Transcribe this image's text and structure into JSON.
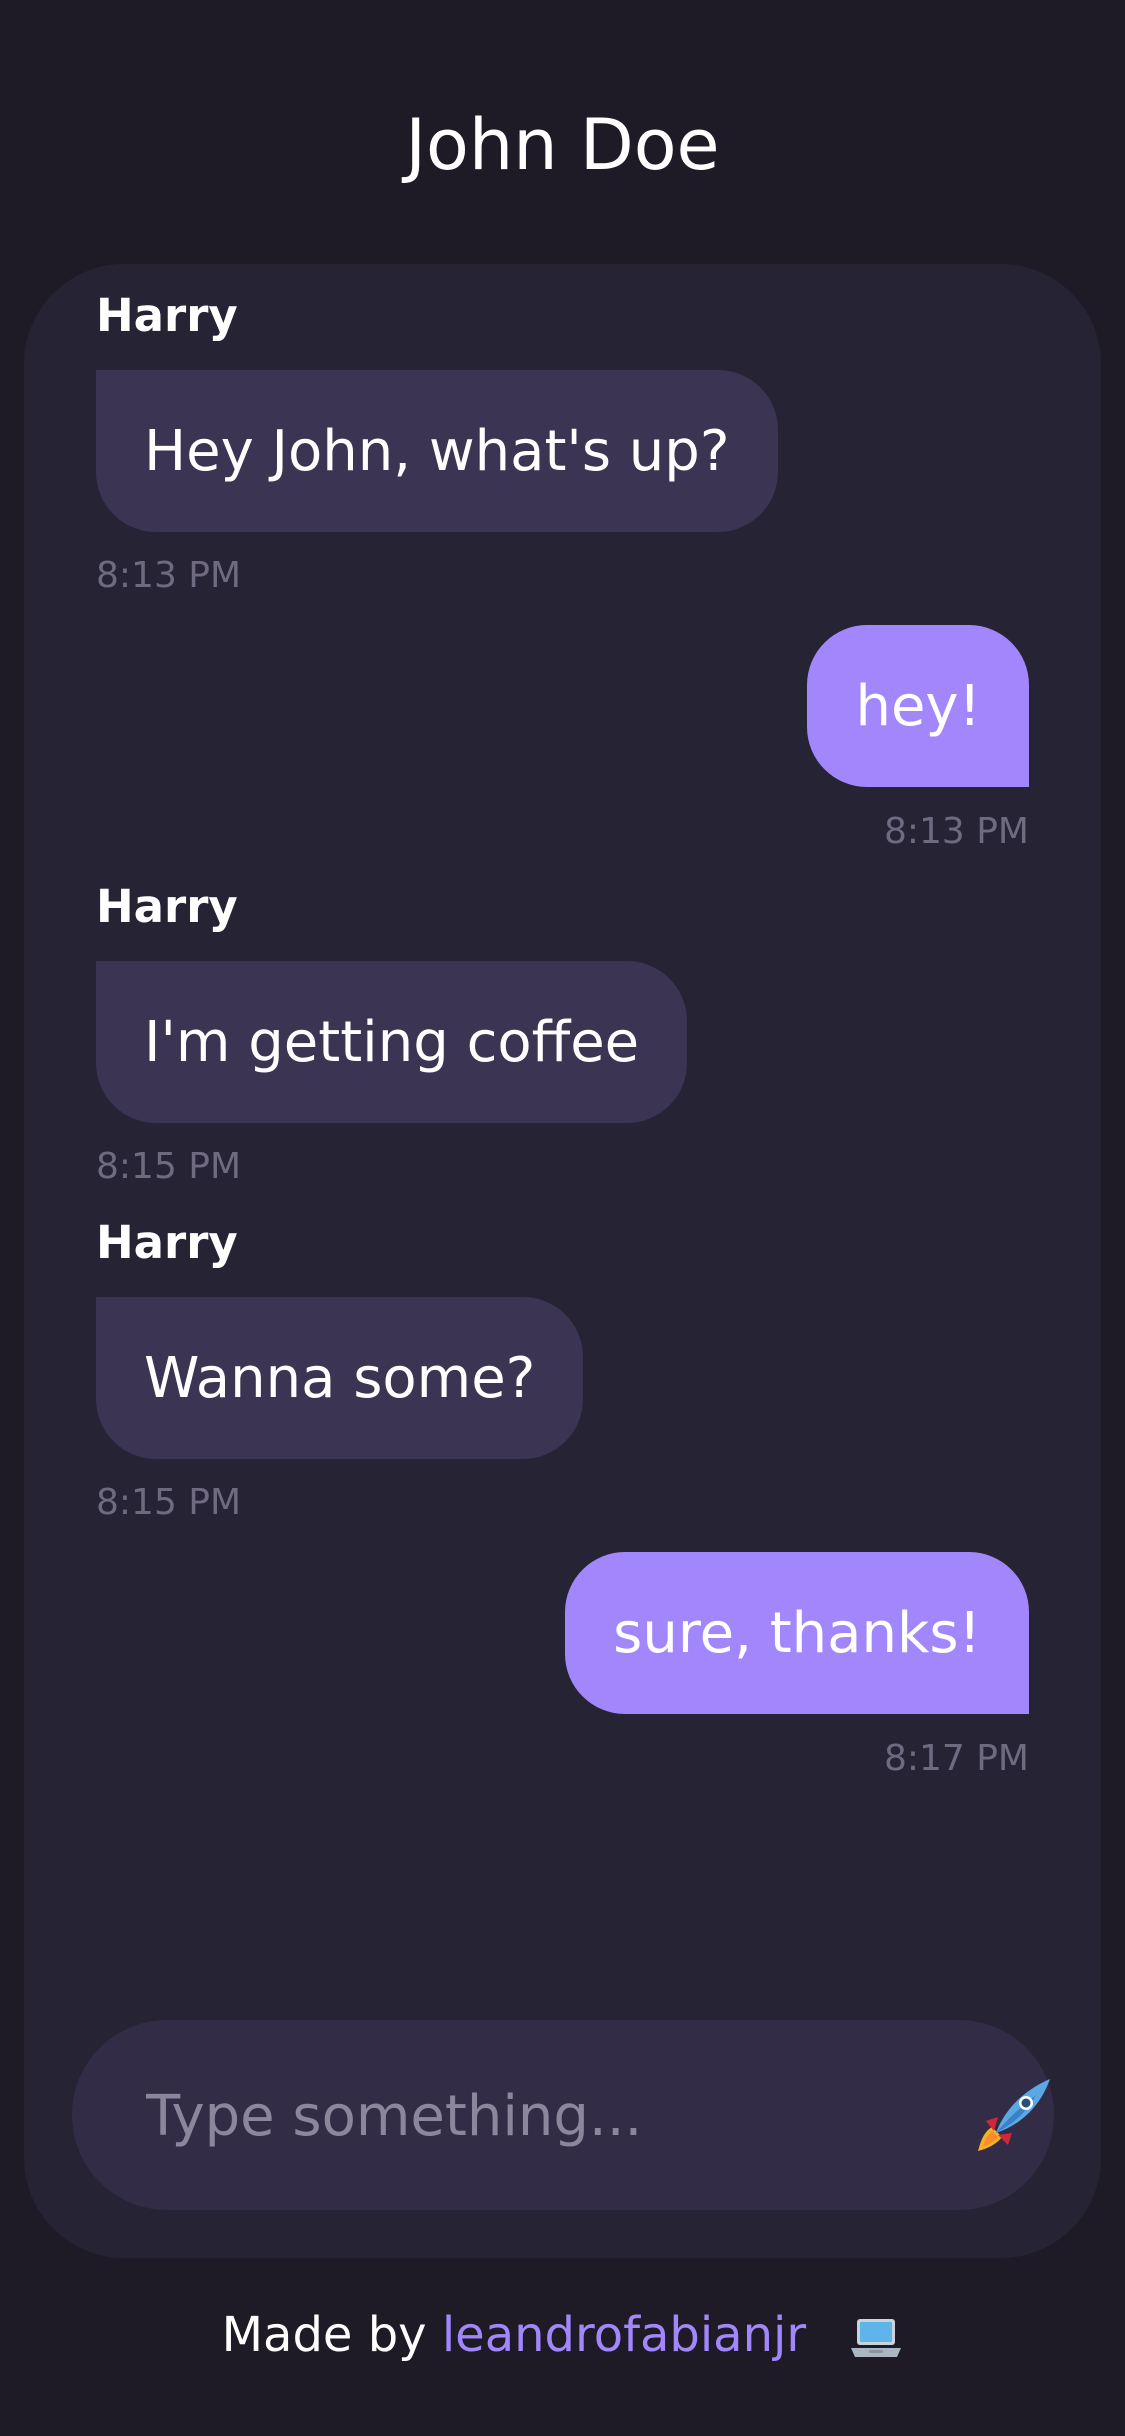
{
  "header": {
    "title": "John Doe"
  },
  "messages": [
    {
      "direction": "in",
      "sender": "Harry",
      "text": "Hey John, what's up?",
      "time": "8:13 PM"
    },
    {
      "direction": "out",
      "text": "hey!",
      "time": "8:13 PM"
    },
    {
      "direction": "in",
      "sender": "Harry",
      "text": "I'm getting coffee",
      "time": "8:15 PM"
    },
    {
      "direction": "in",
      "sender": "Harry",
      "text": "Wanna some?",
      "time": "8:15 PM"
    },
    {
      "direction": "out",
      "text": "sure, thanks!",
      "time": "8:17 PM"
    }
  ],
  "composer": {
    "placeholder": "Type something...",
    "send_icon": "rocket-icon"
  },
  "footer": {
    "prefix": "Made by ",
    "author": "leandrofabianjr",
    "icon": "laptop-icon"
  },
  "colors": {
    "background": "#1e1b26",
    "card": "#262335",
    "incoming_bubble": "#3b3452",
    "outgoing_bubble": "#a286fb",
    "accent": "#a286fb",
    "timestamp": "#6f6a80"
  }
}
